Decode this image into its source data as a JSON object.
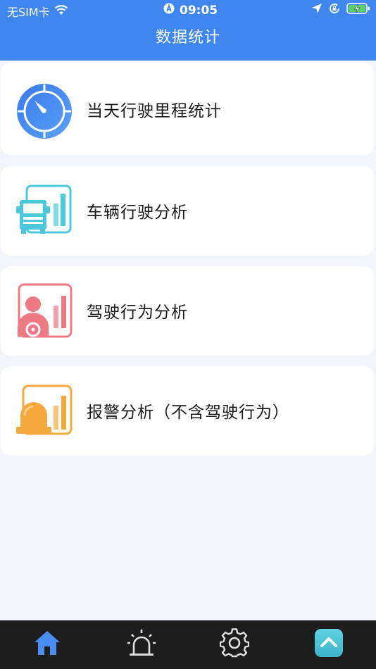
{
  "status_bar": {
    "carrier": "无SIM卡",
    "time": "09:05",
    "icons": [
      "wifi-icon",
      "location-a-icon",
      "location-arrow-icon",
      "rotation-lock-icon",
      "battery-charging-icon"
    ]
  },
  "header": {
    "title": "数据统计"
  },
  "menu": [
    {
      "label": "当天行驶里程统计",
      "icon": "speedometer-icon"
    },
    {
      "label": "车辆行驶分析",
      "icon": "truck-chart-icon"
    },
    {
      "label": "驾驶行为分析",
      "icon": "driver-chart-icon"
    },
    {
      "label": "报警分析（不含驾驶行为）",
      "icon": "alarm-chart-icon"
    }
  ],
  "tabbar": {
    "tabs": [
      {
        "icon": "home-icon",
        "active": true
      },
      {
        "icon": "alarm-light-icon"
      },
      {
        "icon": "gear-icon"
      },
      {
        "icon": "scroll-up-icon"
      }
    ]
  },
  "colors": {
    "header": "#3f86ee",
    "background": "#f2f5fb",
    "tabbar": "#1d1d1d",
    "speedometer": "#4a8cf0",
    "truck": "#4cc8dc",
    "driver": "#ee7a85",
    "alarm": "#f5a93c"
  }
}
